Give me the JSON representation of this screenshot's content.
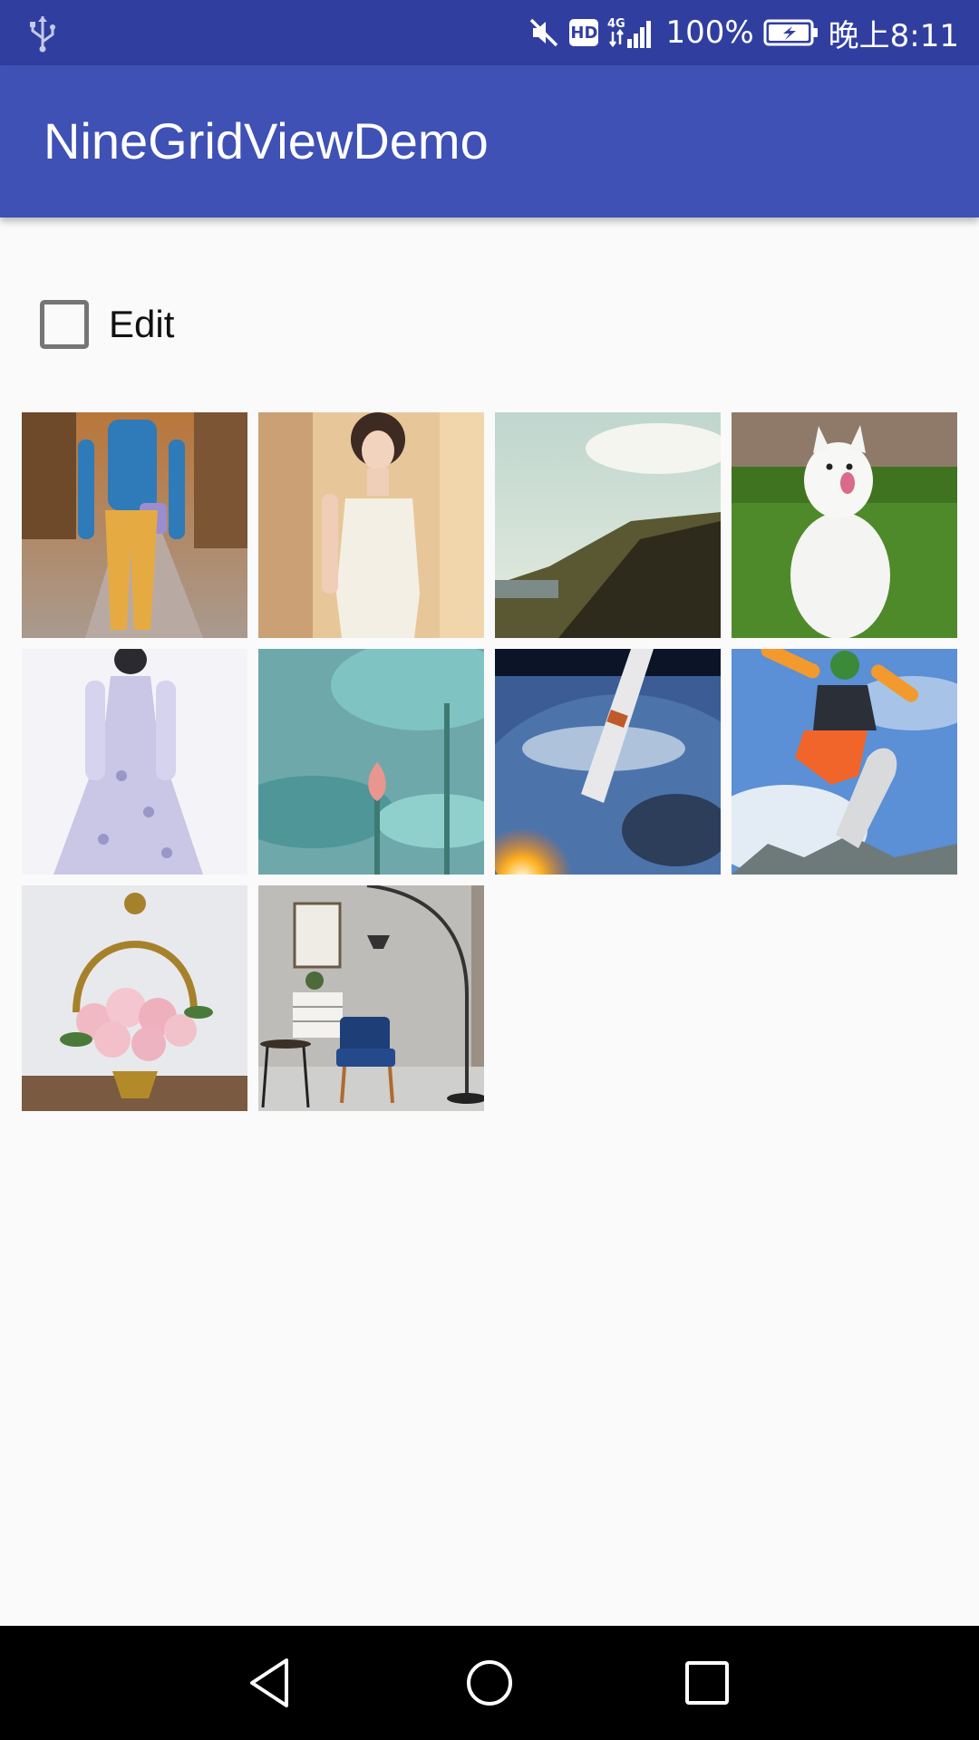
{
  "status_bar": {
    "battery": "100%",
    "time": "晚上8:11",
    "hd_label": "HD",
    "network_label": "4G",
    "icons": [
      "usb-icon",
      "mute-icon",
      "hd-icon",
      "signal-4g-icon",
      "battery-charging-icon"
    ]
  },
  "app_bar": {
    "title": "NineGridViewDemo"
  },
  "edit": {
    "label": "Edit",
    "checked": false
  },
  "grid": {
    "images": [
      "woman-blue-sweater-autumn-photo",
      "woman-white-dress-photo",
      "hillside-landscape-photo",
      "white-dog-grass-photo",
      "lavender-gown-photo",
      "lotus-bud-teal-photo",
      "rocket-launch-earth-photo",
      "snowboarder-jump-photo",
      "rose-basket-photo",
      "living-room-armchair-photo"
    ]
  },
  "nav_bar": {
    "buttons": [
      "back-icon",
      "home-icon",
      "recents-icon"
    ]
  },
  "colors": {
    "status_bar": "#303f9f",
    "app_bar": "#3f51b5",
    "background": "#fafafa",
    "nav_bar": "#000000"
  }
}
